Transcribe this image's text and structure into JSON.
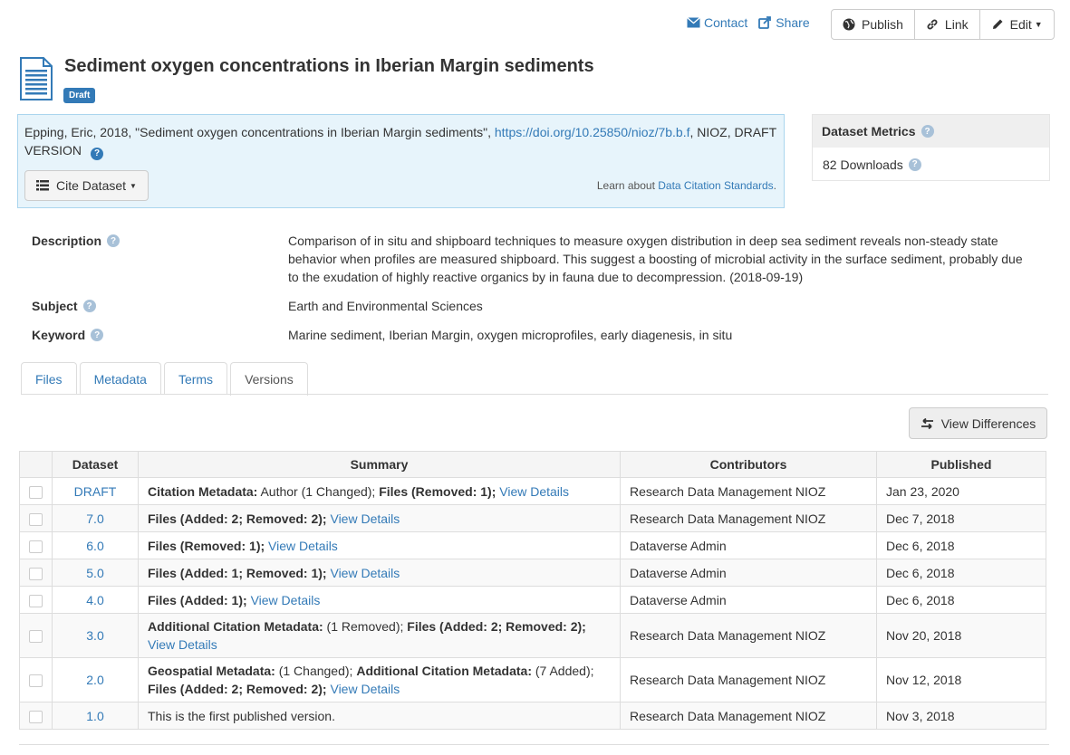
{
  "toolbar": {
    "contact_label": "Contact",
    "share_label": "Share",
    "publish_label": "Publish",
    "link_label": "Link",
    "edit_label": "Edit"
  },
  "dataset": {
    "title": "Sediment oxygen concentrations in Iberian Margin sediments",
    "status_badge": "Draft"
  },
  "citation": {
    "text_before": "Epping, Eric, 2018, \"Sediment oxygen concentrations in Iberian Margin sediments\", ",
    "doi": "https://doi.org/10.25850/nioz/7b.b.f",
    "text_after": ", NIOZ, DRAFT VERSION",
    "cite_button": "Cite Dataset",
    "learn_prefix": "Learn about ",
    "learn_link": "Data Citation Standards",
    "learn_suffix": "."
  },
  "metrics": {
    "title": "Dataset Metrics",
    "downloads": "82 Downloads"
  },
  "metadata": {
    "description_label": "Description",
    "description_value": "Comparison of in situ and shipboard techniques to measure oxygen distribution in deep sea sediment reveals non-steady state behavior when profiles are measured shipboard. This suggest a boosting of microbial activity in the surface sediment, probably due to the exudation of highly reactive organics by in fauna due to decompression. (2018-09-19)",
    "subject_label": "Subject",
    "subject_value": "Earth and Environmental Sciences",
    "keyword_label": "Keyword",
    "keyword_value": "Marine sediment, Iberian Margin, oxygen microprofiles, early diagenesis, in situ"
  },
  "tabs": [
    "Files",
    "Metadata",
    "Terms",
    "Versions"
  ],
  "active_tab": "Versions",
  "view_differences": "View Differences",
  "versions_table": {
    "headers": [
      "Dataset",
      "Summary",
      "Contributors",
      "Published"
    ],
    "rows": [
      {
        "version": "DRAFT",
        "summary": [
          {
            "b": "Citation Metadata:"
          },
          {
            "t": " Author (1 Changed); "
          },
          {
            "b": "Files (Removed: 1);"
          },
          {
            "t": " "
          },
          {
            "a": "View Details"
          }
        ],
        "contributors": "Research Data Management NIOZ",
        "published": "Jan 23, 2020"
      },
      {
        "version": "7.0",
        "summary": [
          {
            "b": "Files (Added: 2; Removed: 2);"
          },
          {
            "t": " "
          },
          {
            "a": "View Details"
          }
        ],
        "contributors": "Research Data Management NIOZ",
        "published": "Dec 7, 2018"
      },
      {
        "version": "6.0",
        "summary": [
          {
            "b": "Files (Removed: 1);"
          },
          {
            "t": " "
          },
          {
            "a": "View Details"
          }
        ],
        "contributors": "Dataverse Admin",
        "published": "Dec 6, 2018"
      },
      {
        "version": "5.0",
        "summary": [
          {
            "b": "Files (Added: 1; Removed: 1);"
          },
          {
            "t": " "
          },
          {
            "a": "View Details"
          }
        ],
        "contributors": "Dataverse Admin",
        "published": "Dec 6, 2018"
      },
      {
        "version": "4.0",
        "summary": [
          {
            "b": "Files (Added: 1);"
          },
          {
            "t": " "
          },
          {
            "a": "View Details"
          }
        ],
        "contributors": "Dataverse Admin",
        "published": "Dec 6, 2018"
      },
      {
        "version": "3.0",
        "summary": [
          {
            "b": "Additional Citation Metadata:"
          },
          {
            "t": " (1 Removed); "
          },
          {
            "b": "Files (Added: 2; Removed: 2);"
          },
          {
            "t": " "
          },
          {
            "a": "View Details"
          }
        ],
        "contributors": "Research Data Management NIOZ",
        "published": "Nov 20, 2018"
      },
      {
        "version": "2.0",
        "summary": [
          {
            "b": "Geospatial Metadata:"
          },
          {
            "t": " (1 Changed); "
          },
          {
            "b": "Additional Citation Metadata:"
          },
          {
            "t": " (7 Added); "
          },
          {
            "b": "Files (Added: 2; Removed: 2);"
          },
          {
            "t": " "
          },
          {
            "a": "View Details"
          }
        ],
        "contributors": "Research Data Management NIOZ",
        "published": "Nov 12, 2018"
      },
      {
        "version": "1.0",
        "summary": [
          {
            "t": "This is the first published version."
          }
        ],
        "contributors": "Research Data Management NIOZ",
        "published": "Nov 3, 2018"
      }
    ]
  },
  "colors": {
    "link": "#337ab7",
    "badge": "#337ab7",
    "citation_bg": "#e7f4fb",
    "citation_border": "#aad5ee"
  }
}
